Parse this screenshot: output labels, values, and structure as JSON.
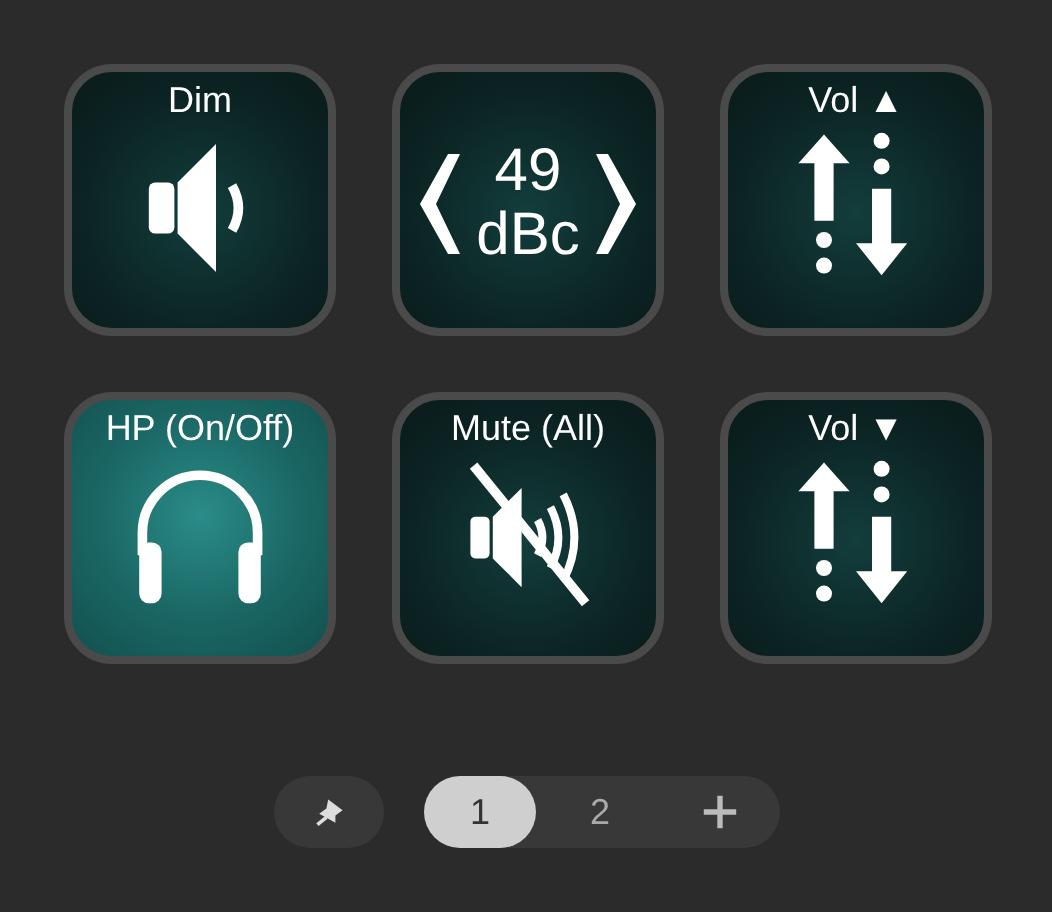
{
  "tiles": [
    {
      "kind": "dim",
      "label": "Dim",
      "active": false
    },
    {
      "kind": "level",
      "value": "49",
      "unit": "dBc",
      "active": false
    },
    {
      "kind": "vol-up",
      "label": "Vol ▲",
      "active": false
    },
    {
      "kind": "headphones",
      "label": "HP (On/Off)",
      "active": true
    },
    {
      "kind": "mute",
      "label": "Mute (All)",
      "active": false
    },
    {
      "kind": "vol-down",
      "label": "Vol ▼",
      "active": false
    }
  ],
  "pages": [
    {
      "label": "1",
      "selected": true
    },
    {
      "label": "2",
      "selected": false
    }
  ]
}
